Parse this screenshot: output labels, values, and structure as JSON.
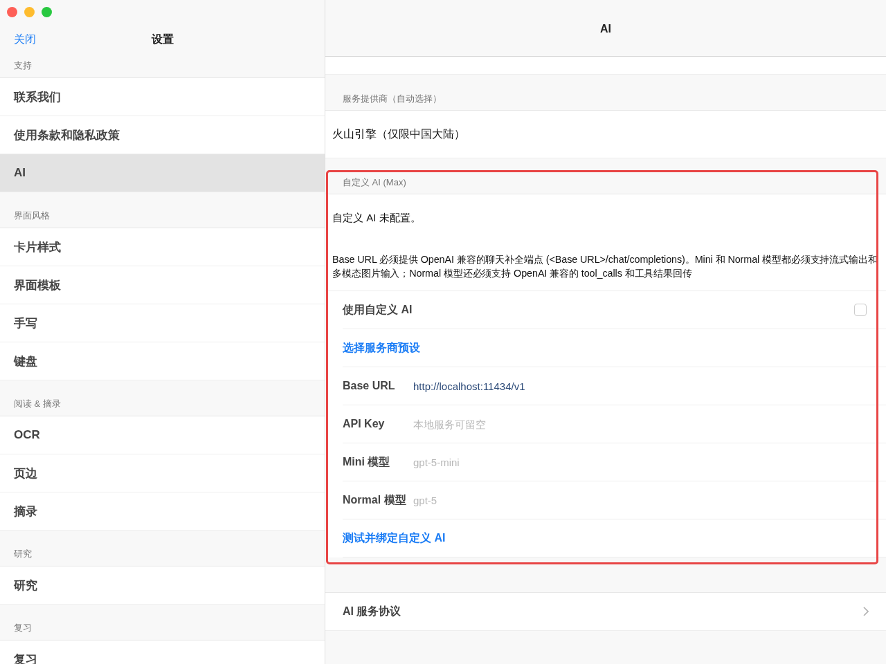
{
  "sidebar": {
    "close": "关闭",
    "title": "设置",
    "groups": [
      {
        "header": "支持",
        "items": [
          {
            "label": "联系我们",
            "selected": false
          },
          {
            "label": "使用条款和隐私政策",
            "selected": false
          },
          {
            "label": "AI",
            "selected": true
          }
        ]
      },
      {
        "header": "界面风格",
        "items": [
          {
            "label": "卡片样式",
            "selected": false
          },
          {
            "label": "界面模板",
            "selected": false
          },
          {
            "label": "手写",
            "selected": false
          },
          {
            "label": "键盘",
            "selected": false
          }
        ]
      },
      {
        "header": "阅读 & 摘录",
        "items": [
          {
            "label": "OCR",
            "selected": false
          },
          {
            "label": "页边",
            "selected": false
          },
          {
            "label": "摘录",
            "selected": false
          }
        ]
      },
      {
        "header": "研究",
        "items": [
          {
            "label": "研究",
            "selected": false
          }
        ]
      },
      {
        "header": "复习",
        "items": [
          {
            "label": "复习",
            "selected": false
          }
        ]
      }
    ]
  },
  "detail": {
    "title": "AI",
    "provider": {
      "header": "服务提供商（自动选择）",
      "value": "火山引擎（仅限中国大陆）"
    },
    "custom": {
      "header": "自定义 AI (Max)",
      "status": "自定义 AI 未配置。",
      "description": "Base URL 必须提供 OpenAI 兼容的聊天补全端点 (<Base URL>/chat/completions)。Mini 和 Normal 模型都必须支持流式输出和多模态图片输入；Normal 模型还必须支持 OpenAI 兼容的 tool_calls 和工具结果回传",
      "rows": [
        {
          "kind": "toggle",
          "label": "使用自定义 AI",
          "checked": false
        },
        {
          "kind": "link",
          "label": "选择服务商预设"
        },
        {
          "kind": "field",
          "label": "Base URL",
          "value": "http://localhost:11434/v1"
        },
        {
          "kind": "field",
          "label": "API Key",
          "placeholder": "本地服务可留空"
        },
        {
          "kind": "field",
          "label": "Mini 模型",
          "placeholder": "gpt-5-mini"
        },
        {
          "kind": "field",
          "label": "Normal 模型",
          "placeholder": "gpt-5"
        },
        {
          "kind": "link",
          "label": "测试并绑定自定义 AI"
        }
      ]
    },
    "agreement": {
      "label": "AI 服务协议"
    }
  }
}
